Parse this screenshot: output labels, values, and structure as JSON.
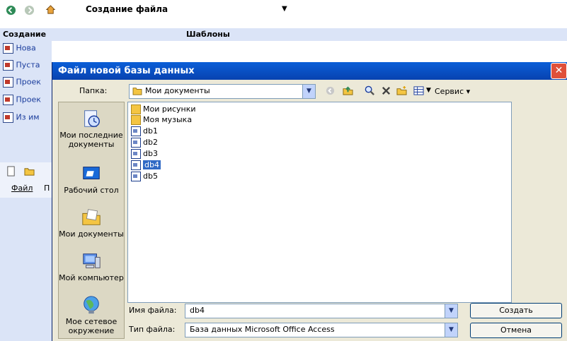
{
  "window": {
    "toolbar_title": "Создание файла",
    "dropdown_arrow": "▼",
    "pane_heading_left": "Создание",
    "pane_heading_right": "Шаблоны",
    "pane_items": [
      "Нова",
      "Пуста",
      "Проек",
      "Проек",
      "Из им"
    ],
    "menu_file": "Файл",
    "menu_next": "П"
  },
  "dialog": {
    "title": "Файл новой базы данных",
    "close_label": "✕",
    "folder_label": "Папка:",
    "folder_value": "Мои документы",
    "service_label": "Сервис",
    "places": [
      "Мои последние документы",
      "Рабочий стол",
      "Мои документы",
      "Мой компьютер",
      "Мое сетевое окружение"
    ],
    "files": [
      {
        "name": "Мои рисунки",
        "type": "folder"
      },
      {
        "name": "Моя музыка",
        "type": "folder"
      },
      {
        "name": "db1",
        "type": "db"
      },
      {
        "name": "db2",
        "type": "db"
      },
      {
        "name": "db3",
        "type": "db"
      },
      {
        "name": "db4",
        "type": "db",
        "selected": true
      },
      {
        "name": "db5",
        "type": "db"
      }
    ],
    "filename_label": "Имя файла:",
    "filename_value": "db4",
    "filetype_label": "Тип файла:",
    "filetype_value": "База данных Microsoft Office Access",
    "create_button": "Создать",
    "cancel_button": "Отмена"
  },
  "colors": {
    "title_bar": "#0842b0",
    "selection": "#316ac5",
    "dialog_bg": "#ece9d8"
  }
}
